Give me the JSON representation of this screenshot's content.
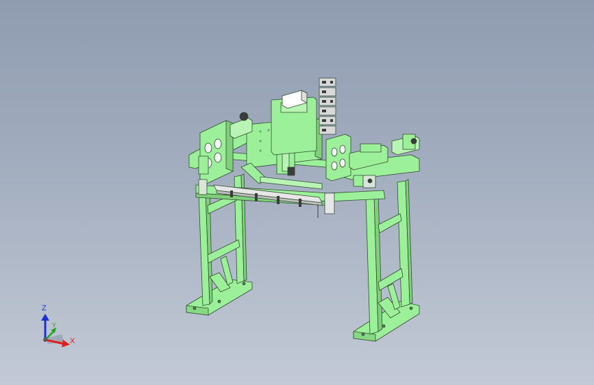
{
  "viewport": {
    "background_top": "#8f9cb0",
    "background_bottom": "#c3cad6"
  },
  "model": {
    "part_color": "#9df09a",
    "edge_color": "#2f4a2f",
    "dark_color": "#3c3c3c"
  },
  "triad": {
    "x_label": "X",
    "y_label": "Y",
    "z_label": "Z",
    "x_color": "#e01e1e",
    "y_color": "#22a322",
    "z_color": "#1c2fd6"
  }
}
